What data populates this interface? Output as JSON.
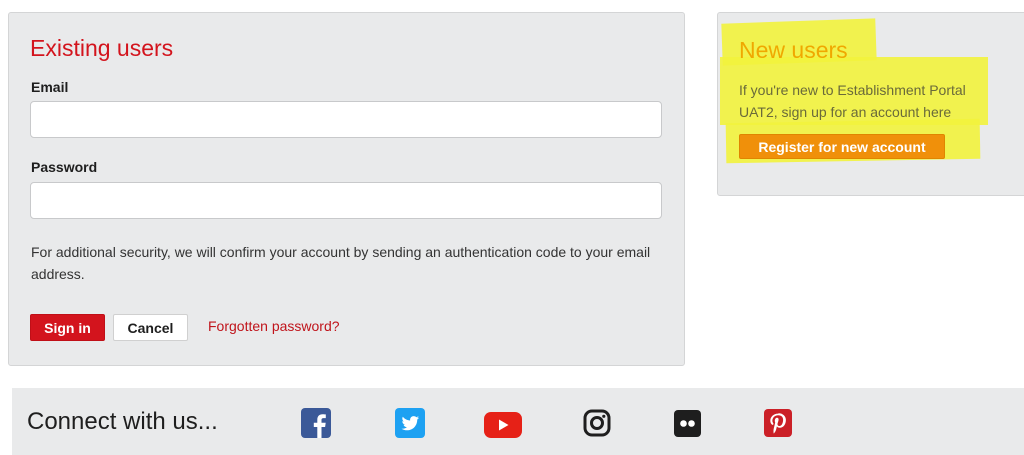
{
  "existing_users": {
    "heading": "Existing users",
    "email_label": "Email",
    "email_value": "",
    "password_label": "Password",
    "password_value": "",
    "security_note": "For additional security, we will confirm your account by sending an authentication code to your email address.",
    "sign_in_label": "Sign in",
    "cancel_label": "Cancel",
    "forgotten_label": "Forgotten password?"
  },
  "new_users": {
    "heading": "New users",
    "description": "If you're new to Establishment Portal UAT2, sign up for an account here",
    "register_label": "Register for new account",
    "highlight_color": "#f2f33d"
  },
  "footer": {
    "title": "Connect with us...",
    "social": [
      {
        "name": "facebook-icon",
        "color": "#3b5998"
      },
      {
        "name": "twitter-icon",
        "color": "#1da1f2"
      },
      {
        "name": "youtube-icon",
        "color": "#e62117"
      },
      {
        "name": "instagram-icon",
        "color": "#1e1e1e"
      },
      {
        "name": "flickr-icon",
        "color": "#1e1e1e"
      },
      {
        "name": "pinterest-icon",
        "color": "#cb2027"
      }
    ]
  },
  "colors": {
    "accent": "#d3141d",
    "panel_bg": "#e9eaeb",
    "register_button": "#f0900a"
  }
}
